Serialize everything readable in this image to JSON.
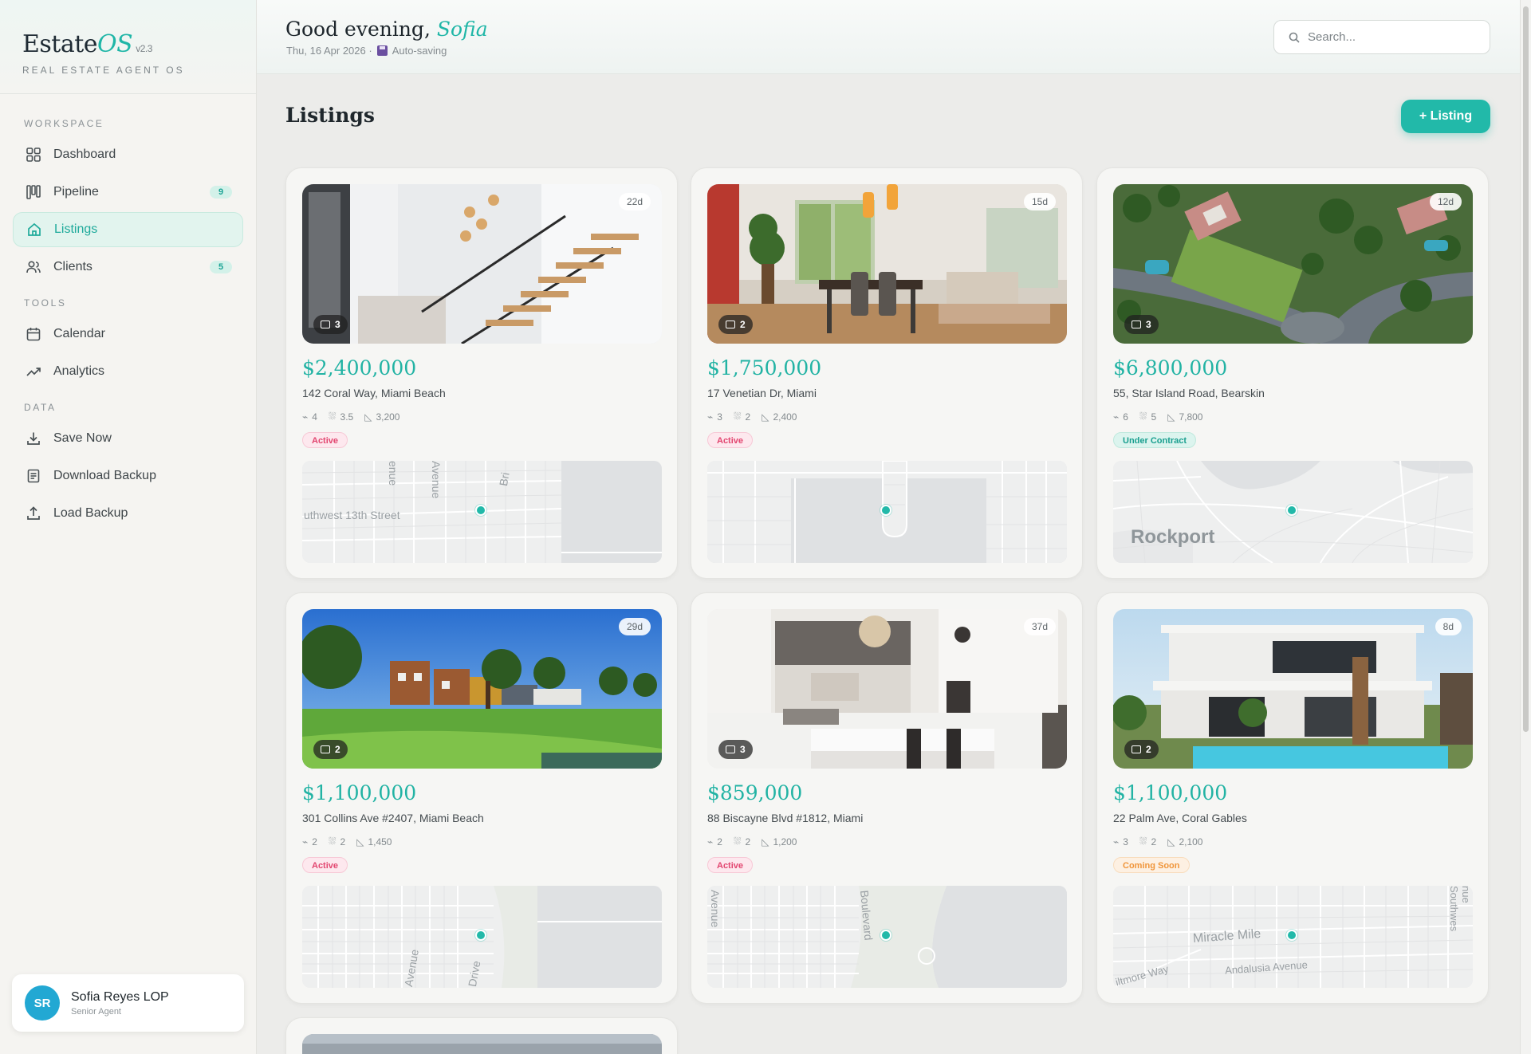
{
  "brand": {
    "name": "Estate",
    "accent": "OS",
    "version": "v2.3",
    "tagline": "REAL ESTATE AGENT OS"
  },
  "nav": {
    "workspace_label": "WORKSPACE",
    "tools_label": "TOOLS",
    "data_label": "DATA",
    "items": [
      {
        "label": "Dashboard",
        "icon": "grid-icon"
      },
      {
        "label": "Pipeline",
        "icon": "kanban-icon",
        "count": "9"
      },
      {
        "label": "Listings",
        "icon": "home-icon",
        "active": true
      },
      {
        "label": "Clients",
        "icon": "users-icon",
        "count": "5"
      },
      {
        "label": "Calendar",
        "icon": "calendar-icon"
      },
      {
        "label": "Analytics",
        "icon": "trend-icon"
      },
      {
        "label": "Save Now",
        "icon": "download-icon"
      },
      {
        "label": "Download Backup",
        "icon": "document-icon"
      },
      {
        "label": "Load Backup",
        "icon": "upload-icon"
      }
    ]
  },
  "user": {
    "initials": "SR",
    "name": "Sofia Reyes LOP",
    "role": "Senior Agent"
  },
  "header": {
    "greeting": "Good evening,",
    "name": "Sofia",
    "date": "Thu, 16 Apr 2026 ·",
    "autosave": "Auto-saving",
    "search_placeholder": "Search..."
  },
  "page": {
    "title": "Listings",
    "add_button": "+ Listing"
  },
  "colors": {
    "accent": "#22b9a9",
    "active_status": "#e2456f",
    "contract_status": "#1a9f8f",
    "soon_status": "#f0953a"
  },
  "listings": [
    {
      "price": "$2,400,000",
      "address": "142 Coral Way, Miami Beach",
      "beds": "4",
      "baths": "3.5",
      "sqft": "3,200",
      "status": "Active",
      "days": "22d",
      "photos": "3",
      "map_label": "uthwest 13th Street",
      "map_label2": "Avenue",
      "map_label3": "enue",
      "map_label4": "Bri"
    },
    {
      "price": "$1,750,000",
      "address": "17 Venetian Dr, Miami",
      "beds": "3",
      "baths": "2",
      "sqft": "2,400",
      "status": "Active",
      "days": "15d",
      "photos": "2"
    },
    {
      "price": "$6,800,000",
      "address": "55, Star Island Road, Bearskin",
      "beds": "6",
      "baths": "5",
      "sqft": "7,800",
      "status": "Under Contract",
      "days": "12d",
      "photos": "3",
      "map_label": "Rockport"
    },
    {
      "price": "$1,100,000",
      "address": "301 Collins Ave #2407, Miami Beach",
      "beds": "2",
      "baths": "2",
      "sqft": "1,450",
      "status": "Active",
      "days": "29d",
      "photos": "2",
      "map_label": "Avenue",
      "map_label2": "Drive"
    },
    {
      "price": "$859,000",
      "address": "88 Biscayne Blvd #1812, Miami",
      "beds": "2",
      "baths": "2",
      "sqft": "1,200",
      "status": "Active",
      "days": "37d",
      "photos": "3",
      "map_label": "Boulevard",
      "map_label2": "Avenue"
    },
    {
      "price": "$1,100,000",
      "address": "22 Palm Ave, Coral Gables",
      "beds": "3",
      "baths": "2",
      "sqft": "2,100",
      "status": "Coming Soon",
      "days": "8d",
      "photos": "2",
      "map_label": "Miracle Mile",
      "map_label2": "Andalusia Avenue",
      "map_label3": "iltmore Way",
      "map_label4": "nue Southwes"
    }
  ]
}
